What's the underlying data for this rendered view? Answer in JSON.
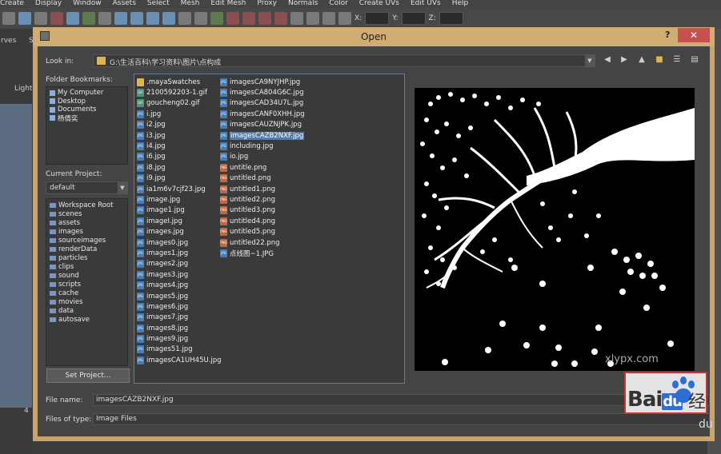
{
  "menubar": [
    "Create",
    "Display",
    "Window",
    "Assets",
    "Select",
    "Mesh",
    "Edit Mesh",
    "Proxy",
    "Normals",
    "Color",
    "Create UVs",
    "Edit UVs",
    "Help"
  ],
  "toolbar": {
    "x_label": "X:",
    "y_label": "Y:",
    "z_label": "Z:"
  },
  "left_strip": {
    "tab1": "rves",
    "tab2": "S",
    "lighting": "Lightin",
    "num": "4"
  },
  "dialog": {
    "title": "Open",
    "help": "?",
    "close": "✕",
    "look_in_label": "Look in:",
    "path": "G:\\生活百科\\学习资料\\图片\\点构成",
    "folder_bookmarks_label": "Folder Bookmarks:",
    "bookmarks": [
      "My Computer",
      "Desktop",
      "Documents",
      "杨倩奕"
    ],
    "current_project_label": "Current Project:",
    "current_project": "default",
    "project_tree": [
      "Workspace Root",
      "scenes",
      "assets",
      "images",
      "sourceimages",
      "renderData",
      "particles",
      "clips",
      "sound",
      "scripts",
      "cache",
      "movies",
      "data",
      "autosave"
    ],
    "set_project": "Set Project...",
    "files_col1": [
      {
        "name": ".mayaSwatches",
        "type": "folder"
      },
      {
        "name": "2100592203-1.gif",
        "type": "gif"
      },
      {
        "name": "goucheng02.gif",
        "type": "gif"
      },
      {
        "name": "i.jpg",
        "type": "jpg"
      },
      {
        "name": "i2.jpg",
        "type": "jpg"
      },
      {
        "name": "i3.jpg",
        "type": "jpg"
      },
      {
        "name": "i4.jpg",
        "type": "jpg"
      },
      {
        "name": "i6.jpg",
        "type": "jpg"
      },
      {
        "name": "i8.jpg",
        "type": "jpg"
      },
      {
        "name": "i9.jpg",
        "type": "jpg"
      },
      {
        "name": "ia1m6v7cjf23.jpg",
        "type": "jpg"
      },
      {
        "name": "image.jpg",
        "type": "jpg"
      },
      {
        "name": "image1.jpg",
        "type": "jpg"
      },
      {
        "name": "imageI.jpg",
        "type": "jpg"
      },
      {
        "name": "images.jpg",
        "type": "jpg"
      },
      {
        "name": "images0.jpg",
        "type": "jpg"
      },
      {
        "name": "images1.jpg",
        "type": "jpg"
      },
      {
        "name": "images2.jpg",
        "type": "jpg"
      },
      {
        "name": "images3.jpg",
        "type": "jpg"
      },
      {
        "name": "images4.jpg",
        "type": "jpg"
      },
      {
        "name": "images5.jpg",
        "type": "jpg"
      },
      {
        "name": "images6.jpg",
        "type": "jpg"
      },
      {
        "name": "images7.jpg",
        "type": "jpg"
      },
      {
        "name": "images8.jpg",
        "type": "jpg"
      },
      {
        "name": "images9.jpg",
        "type": "jpg"
      },
      {
        "name": "images51.jpg",
        "type": "jpg"
      },
      {
        "name": "imagesCA1UH45U.jpg",
        "type": "jpg"
      }
    ],
    "files_col2": [
      {
        "name": "imagesCA9NYJHP.jpg",
        "type": "jpg"
      },
      {
        "name": "imagesCA804G6C.jpg",
        "type": "jpg"
      },
      {
        "name": "imagesCAD34U7L.jpg",
        "type": "jpg"
      },
      {
        "name": "imagesCANF0XHH.jpg",
        "type": "jpg"
      },
      {
        "name": "imagesCAUZNJPK.jpg",
        "type": "jpg"
      },
      {
        "name": "imagesCAZB2NXF.jpg",
        "type": "jpg",
        "selected": true
      },
      {
        "name": "including.jpg",
        "type": "jpg"
      },
      {
        "name": "io.jpg",
        "type": "jpg"
      },
      {
        "name": "untitle.png",
        "type": "png"
      },
      {
        "name": "untitled.png",
        "type": "png"
      },
      {
        "name": "untitled1.png",
        "type": "png"
      },
      {
        "name": "untitled2.png",
        "type": "png"
      },
      {
        "name": "untitled3.png",
        "type": "png"
      },
      {
        "name": "untitled4.png",
        "type": "png"
      },
      {
        "name": "untitled5.png",
        "type": "png"
      },
      {
        "name": "untitled22.png",
        "type": "png"
      },
      {
        "name": "点线图~1.JPG",
        "type": "jpg"
      }
    ],
    "file_name_label": "File name:",
    "file_name": "imagesCAZB2NXF.jpg",
    "files_of_type_label": "Files of type:",
    "files_of_type": "Image Files",
    "preview_watermark": "xlypx.com"
  },
  "watermark": {
    "brand": "Bai",
    "brand2": "du",
    "suffix": "经",
    "corner": "du"
  },
  "icon_labels": {
    "jpg": "JPG",
    "png": "PNG",
    "gif": "GIF"
  }
}
